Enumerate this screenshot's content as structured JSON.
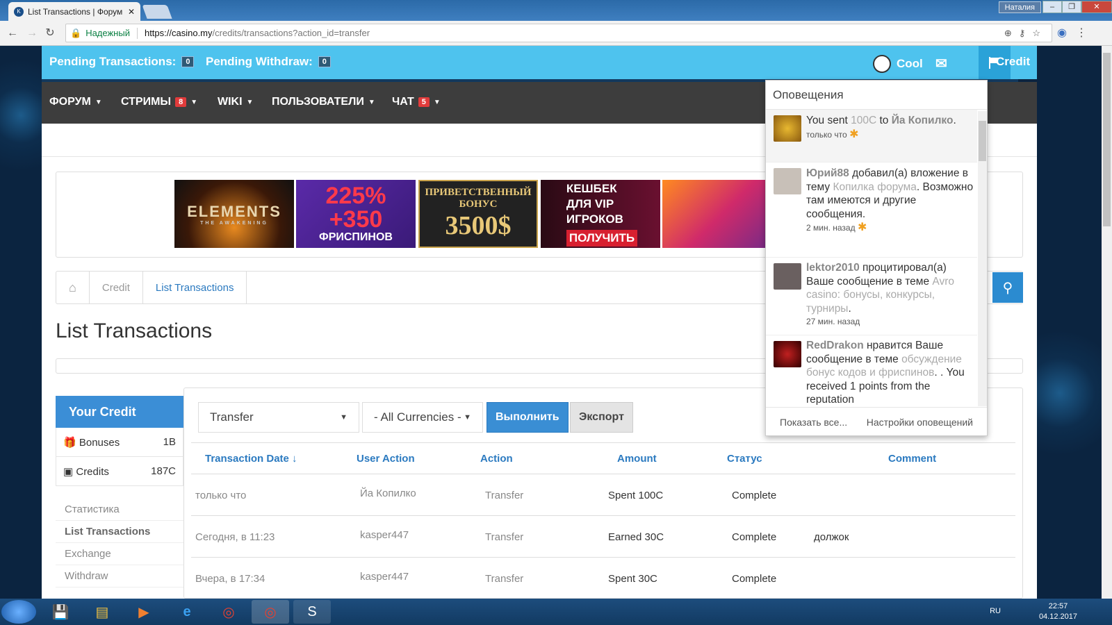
{
  "browser": {
    "tab_title": "List Transactions | Форум",
    "tab_close": "✕",
    "window_user": "Наталия",
    "secure_label": "Надежный",
    "url_host": "https://casino.my",
    "url_path": "/credits/transactions?action_id=transfer"
  },
  "topbar": {
    "pending_transactions_label": "Pending Transactions:",
    "pending_transactions_count": "0",
    "pending_withdraw_label": "Pending Withdraw:",
    "pending_withdraw_count": "0",
    "username": "Cool",
    "credit_label": "Credit"
  },
  "nav": [
    {
      "label": "ФОРУМ",
      "badge": ""
    },
    {
      "label": "СТРИМЫ",
      "badge": "8"
    },
    {
      "label": "WIKI",
      "badge": ""
    },
    {
      "label": "ПОЛЬЗОВАТЕЛИ",
      "badge": ""
    },
    {
      "label": "ЧАТ",
      "badge": "5"
    }
  ],
  "banners": [
    {
      "text": "ELEMENTS",
      "sub": "THE AWAKENING"
    },
    {
      "text": "225%\n+350",
      "sub": "ФРИСПИНОВ"
    },
    {
      "text": "ПРИВЕТСТВЕННЫЙ БОНУС",
      "sub": "3500$"
    },
    {
      "text": "КЕШБЕК ДЛЯ VIP ИГРОКОВ",
      "sub": "ПОЛУЧИТЬ"
    },
    {
      "text": "",
      "sub": ""
    }
  ],
  "breadcrumb": {
    "home": "home",
    "credit": "Credit",
    "current": "List Transactions"
  },
  "page_title": "List Transactions",
  "sidebar": {
    "title": "Your Credit",
    "rows": [
      {
        "label": "Bonuses",
        "value": "1B"
      },
      {
        "label": "Credits",
        "value": "187C"
      }
    ],
    "links": [
      "Статистика",
      "List Transactions",
      "Exchange",
      "Withdraw"
    ]
  },
  "filters": {
    "action_select": "Transfer",
    "currency_select": "- All Currencies -",
    "execute_button": "Выполнить",
    "export_button": "Экспорт"
  },
  "table": {
    "headers": [
      "Transaction Date ↓",
      "User Action",
      "Action",
      "Amount",
      "Статус",
      "Comment"
    ],
    "rows": [
      [
        "только что",
        "Йа Копилко",
        "Transfer",
        "Spent 100C",
        "Complete",
        ""
      ],
      [
        "Сегодня, в 11:23",
        "kasper447",
        "Transfer",
        "Earned 30C",
        "Complete",
        "должок"
      ],
      [
        "Вчера, в 17:34",
        "kasper447",
        "Transfer",
        "Spent 30C",
        "Complete",
        ""
      ]
    ]
  },
  "notifications": {
    "title": "Оповещения",
    "items": [
      {
        "pre": "You sent ",
        "link1": "100C",
        "mid": " to ",
        "who": "Йа Копилко",
        "post": ".",
        "time": "только что",
        "star": "✱"
      },
      {
        "who": "Юрий88",
        "mid": " добавил(а) вложение в тему ",
        "link1": "Копилка форума",
        "post": ". Возможно там имеются и другие сообщения.",
        "time": "2 мин. назад",
        "star": "✱"
      },
      {
        "who": "lektor2010",
        "mid": " процитировал(а) Ваше сообщение в теме ",
        "link1": "Avro casino: бонусы, конкурсы, турниры",
        "post": ".",
        "time": "27 мин. назад",
        "star": ""
      },
      {
        "who": "RedDrakon",
        "mid": " нравится Ваше сообщение в теме ",
        "link1": "обсуждение бонус кодов и фриспинов",
        "post": ". . You received 1 points from the reputation",
        "time": "",
        "star": ""
      }
    ],
    "show_all": "Показать все...",
    "settings": "Настройки оповещений"
  },
  "taskbar": {
    "lang": "RU",
    "time": "22:57",
    "date": "04.12.2017"
  }
}
